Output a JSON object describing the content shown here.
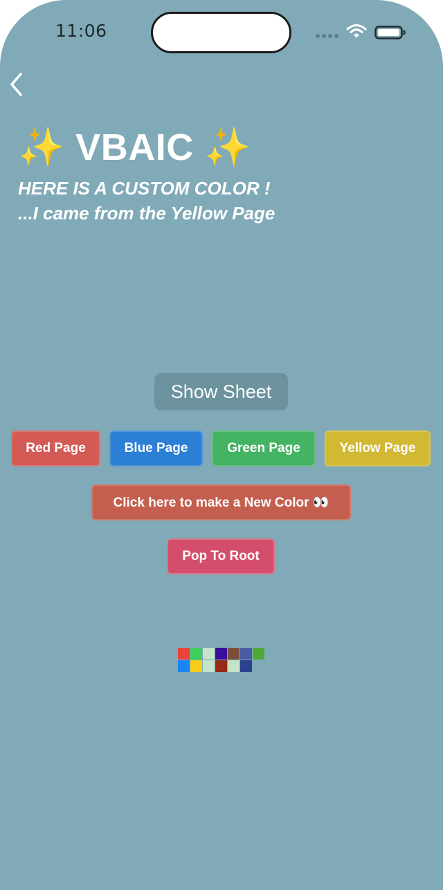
{
  "status_bar": {
    "time": "11:06"
  },
  "navigation": {
    "back_icon": "chevron-left-icon"
  },
  "header": {
    "title": "✨ VBAIC ✨",
    "subtitle_line1": "HERE IS A CUSTOM COLOR !",
    "subtitle_line2": "...I came from the Yellow Page"
  },
  "buttons": {
    "show_sheet": "Show Sheet",
    "red_page": "Red Page",
    "blue_page": "Blue Page",
    "green_page": "Green Page",
    "yellow_page": "Yellow Page",
    "new_color": "Click here to make a New Color 👀",
    "pop_to_root": "Pop To Root"
  },
  "colors": {
    "background": "#80aab7",
    "red_page": "#d45a56",
    "blue_page": "#2b7fd4",
    "green_page": "#45b364",
    "yellow_page": "#d2b934",
    "new_color": "#c45f4f",
    "pop_to_root": "#d44e6b"
  },
  "swatches": {
    "row1": [
      "#e8433b",
      "#3ccf5c",
      "#c4e3c8",
      "#3a0f9a",
      "#7b4f38",
      "#4a5aa5",
      "#4fa93a"
    ],
    "row2": [
      "#1a84f2",
      "#f7cd18",
      "#c4e3c8",
      "#952b18",
      "#c4e3c8",
      "#2b4091"
    ]
  }
}
